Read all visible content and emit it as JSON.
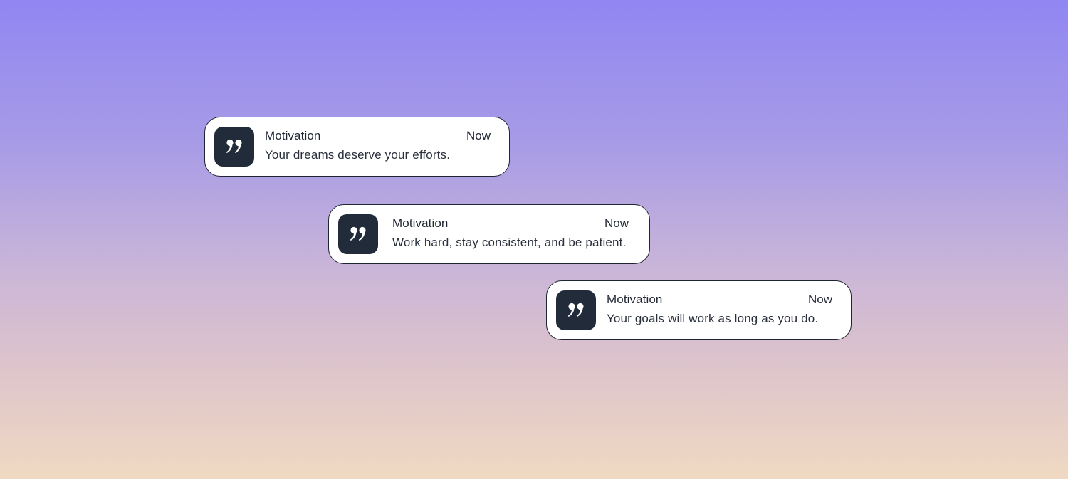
{
  "notifications": [
    {
      "app_name": "Motivation",
      "time": "Now",
      "message": "Your dreams deserve your efforts.",
      "icon": "quote-icon"
    },
    {
      "app_name": "Motivation",
      "time": "Now",
      "message": "Work hard, stay consistent, and be patient.",
      "icon": "quote-icon"
    },
    {
      "app_name": "Motivation",
      "time": "Now",
      "message": "Your goals will work as long as you do.",
      "icon": "quote-icon"
    }
  ],
  "colors": {
    "card_background": "#ffffff",
    "card_border": "#1f2533",
    "icon_background": "#222b39",
    "background_top": "#9186f2",
    "background_bottom": "#f0d9c2"
  }
}
